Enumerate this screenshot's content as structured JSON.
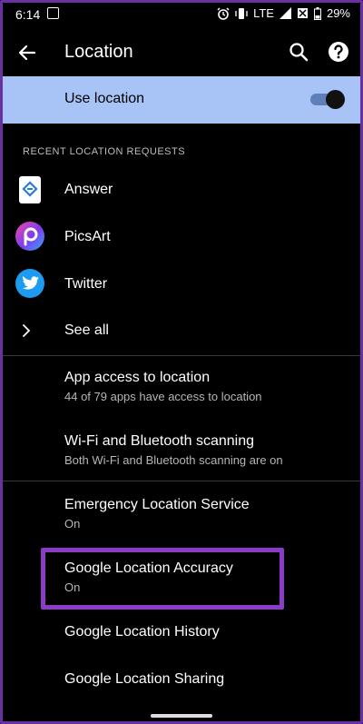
{
  "status_bar": {
    "time": "6:14",
    "notification_glyph": "⊡",
    "network": "LTE",
    "battery": "29%"
  },
  "app_bar": {
    "title": "Location"
  },
  "use_location": {
    "label": "Use location",
    "enabled": true
  },
  "recent_requests": {
    "header": "RECENT LOCATION REQUESTS",
    "apps": [
      {
        "name": "Answer",
        "icon": "answer-app-icon"
      },
      {
        "name": "PicsArt",
        "icon": "picsart-app-icon"
      },
      {
        "name": "Twitter",
        "icon": "twitter-app-icon"
      }
    ],
    "see_all": "See all"
  },
  "settings": {
    "app_access": {
      "title": "App access to location",
      "summary": "44 of 79 apps have access to location"
    },
    "scanning": {
      "title": "Wi-Fi and Bluetooth scanning",
      "summary": "Both Wi-Fi and Bluetooth scanning are on"
    },
    "emergency": {
      "title": "Emergency Location Service",
      "summary": "On"
    },
    "accuracy": {
      "title": "Google Location Accuracy",
      "summary": "On"
    },
    "history": {
      "title": "Google Location History"
    },
    "sharing": {
      "title": "Google Location Sharing"
    }
  },
  "colors": {
    "banner": "#a8c3f6",
    "highlight": "#8c3bc6",
    "frame": "#6a2fa0"
  }
}
